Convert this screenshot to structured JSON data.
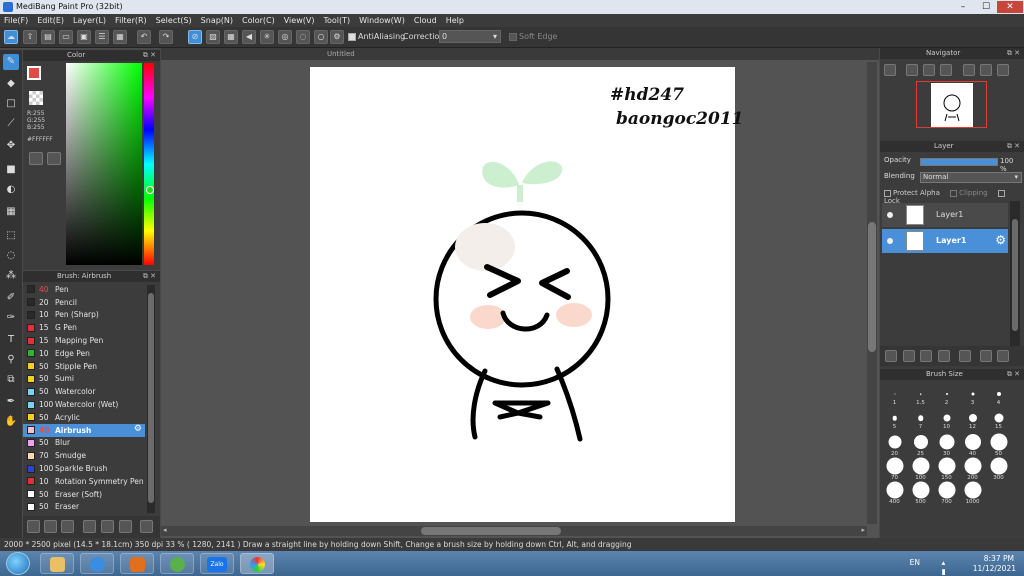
{
  "window": {
    "title": "MediBang Paint Pro (32bit)",
    "min": "–",
    "max": "☐",
    "close": "✕"
  },
  "menu": [
    "File(F)",
    "Edit(E)",
    "Layer(L)",
    "Filter(R)",
    "Select(S)",
    "Snap(N)",
    "Color(C)",
    "View(V)",
    "Tool(T)",
    "Window(W)",
    "Cloud",
    "Help"
  ],
  "options": {
    "antialiasing": "AntiAliasing",
    "correction_label": "Correction",
    "correction_value": "0",
    "soft_edge": "Soft Edge"
  },
  "color_panel": {
    "title": "Color",
    "r": "R:255",
    "g": "G:255",
    "b": "B:255",
    "hex": "#FFFFFF",
    "fg": "#e24b45",
    "bg": "#ffffff"
  },
  "brush_panel": {
    "title": "Brush: Airbrush",
    "items": [
      {
        "size": "40",
        "name": "Pen",
        "color": "#2a2a2a"
      },
      {
        "size": "20",
        "name": "Pencil",
        "color": "#2a2a2a"
      },
      {
        "size": "10",
        "name": "Pen (Sharp)",
        "color": "#2a2a2a"
      },
      {
        "size": "15",
        "name": "G Pen",
        "color": "#e0303a"
      },
      {
        "size": "15",
        "name": "Mapping Pen",
        "color": "#e0303a"
      },
      {
        "size": "10",
        "name": "Edge Pen",
        "color": "#2fb52f"
      },
      {
        "size": "50",
        "name": "Stipple Pen",
        "color": "#f0d020"
      },
      {
        "size": "50",
        "name": "Sumi",
        "color": "#f0d020"
      },
      {
        "size": "50",
        "name": "Watercolor",
        "color": "#7fd0f0"
      },
      {
        "size": "100",
        "name": "Watercolor (Wet)",
        "color": "#7fd0f0"
      },
      {
        "size": "50",
        "name": "Acrylic",
        "color": "#f0d020"
      },
      {
        "size": "40",
        "name": "Airbrush",
        "color": "#f5c0c8"
      },
      {
        "size": "50",
        "name": "Blur",
        "color": "#f0a0f0"
      },
      {
        "size": "70",
        "name": "Smudge",
        "color": "#f8d8b0"
      },
      {
        "size": "100",
        "name": "Sparkle Brush",
        "color": "#3040d0"
      },
      {
        "size": "10",
        "name": "Rotation Symmetry Pen",
        "color": "#e0303a"
      },
      {
        "size": "50",
        "name": "Eraser (Soft)",
        "color": "#ffffff"
      },
      {
        "size": "50",
        "name": "Eraser",
        "color": "#ffffff"
      }
    ],
    "selected_index": 11
  },
  "canvas": {
    "tab": "Untitled",
    "watermark1": "#hd247",
    "watermark2": "baongoc2011"
  },
  "navigator": {
    "title": "Navigator"
  },
  "layer_panel": {
    "title": "Layer",
    "opacity_label": "Opacity",
    "opacity_value": "100 %",
    "opacity_fraction": 1.0,
    "blending_label": "Blending",
    "blending_value": "Normal",
    "protect_alpha": "Protect Alpha",
    "clipping": "Clipping",
    "lock": "Lock",
    "layers": [
      "Layer1",
      "Layer1"
    ]
  },
  "brush_size": {
    "title": "Brush Size",
    "sizes": [
      "1",
      "1.5",
      "2",
      "3",
      "4",
      "5",
      "7",
      "10",
      "12",
      "15",
      "20",
      "25",
      "30",
      "40",
      "50",
      "70",
      "100",
      "150",
      "200",
      "300",
      "400",
      "500",
      "700",
      "1000"
    ]
  },
  "status": {
    "text": "2000 * 2500 pixel   (14.5 * 18.1cm)   350 dpi   33 %   ( 1280, 2141 )   Draw a straight line by holding down Shift, Change a brush size by holding down Ctrl, Alt, and dragging"
  },
  "taskbar": {
    "lang": "EN",
    "time": "8:37 PM",
    "date": "11/12/2021",
    "zalo": "Zalo"
  }
}
